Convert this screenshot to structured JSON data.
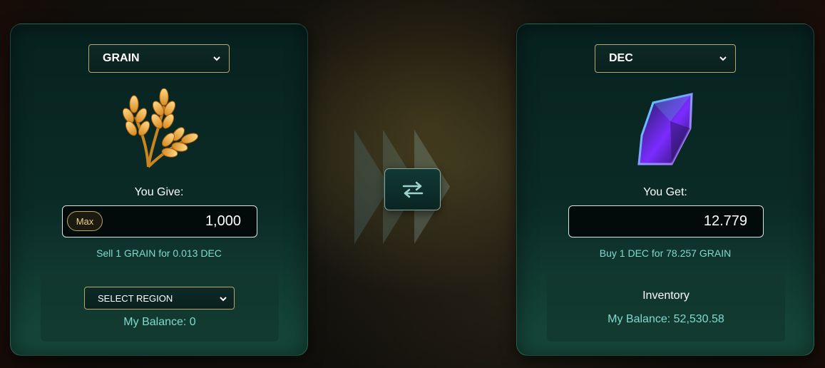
{
  "give": {
    "token": "GRAIN",
    "token_icon": "grain-icon",
    "label": "You Give:",
    "max_label": "Max",
    "amount": "1,000",
    "rate": "Sell 1 GRAIN for 0.013 DEC",
    "region_select": "SELECT REGION",
    "balance": "My Balance: 0"
  },
  "get": {
    "token": "DEC",
    "token_icon": "dec-crystal-icon",
    "label": "You Get:",
    "amount": "12.779",
    "rate": "Buy 1 DEC for 78.257 GRAIN",
    "inventory_title": "Inventory",
    "balance": "My Balance: 52,530.58"
  },
  "swap": {
    "icon": "swap-arrows-icon"
  },
  "colors": {
    "accent_gold": "#b8a56a",
    "rate_teal": "#7fd9cf",
    "panel_dark": "#07221f"
  }
}
